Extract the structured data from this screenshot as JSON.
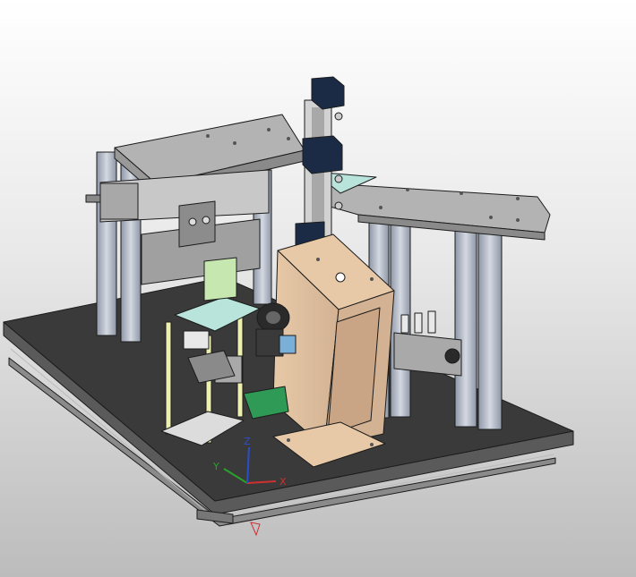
{
  "view": {
    "background_top": "#ffffff",
    "background_bottom": "#bcbcbc"
  },
  "colors": {
    "base_plate": "#3a3a3a",
    "base_plate_edge": "#6a6a6a",
    "profile": "#b6bcc8",
    "plate_gray": "#9a9a9a",
    "plate_top": "#b3b3b3",
    "actuator": "#c8c8c8",
    "motor_block": "#1b2b45",
    "pillar_tan": "#e7c9a8",
    "pillar_tan_dark": "#c9a585",
    "light_cyan": "#b8e4dc",
    "pale_yellow": "#eef0b0",
    "pale_green": "#c6e8b0",
    "pcb_green": "#2e9a55",
    "dark_part": "#2a2a2a",
    "steel_blue": "#7ab0d8"
  },
  "triad": {
    "labels": [
      "Y",
      "Z",
      "X"
    ],
    "icon": "coordinate-triad-icon",
    "colors": {
      "x": "#d03030",
      "y": "#2aa12a",
      "z": "#2a4ec9"
    }
  }
}
